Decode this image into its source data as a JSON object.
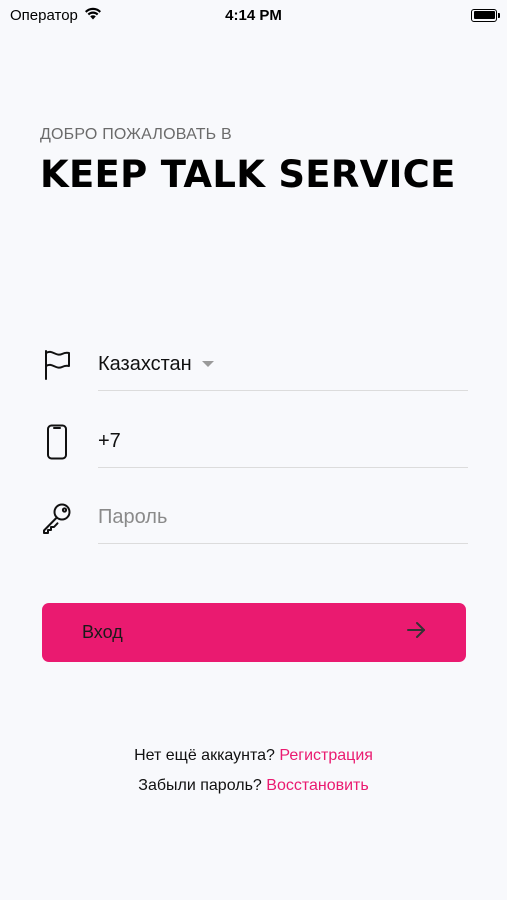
{
  "status_bar": {
    "carrier": "Оператор",
    "time": "4:14 PM",
    "icons": [
      "wifi-icon",
      "battery-icon"
    ]
  },
  "header": {
    "welcome": "ДОБРО ПОЖАЛОВАТЬ В",
    "brand": "KEEP TALK SERVICE"
  },
  "form": {
    "country": {
      "icon": "flag-icon",
      "value": "Казахстан"
    },
    "phone": {
      "icon": "smartphone-icon",
      "value": "+7"
    },
    "password": {
      "icon": "key-icon",
      "placeholder": "Пароль"
    }
  },
  "login_button": {
    "label": "Вход",
    "icon": "arrow-right-icon"
  },
  "footer": {
    "no_account": "Нет ещё аккаунта?",
    "register": "Регистрация",
    "forgot": "Забыли пароль?",
    "restore": "Восстановить"
  },
  "colors": {
    "accent": "#ea1a70",
    "background": "#f8f9fc"
  }
}
